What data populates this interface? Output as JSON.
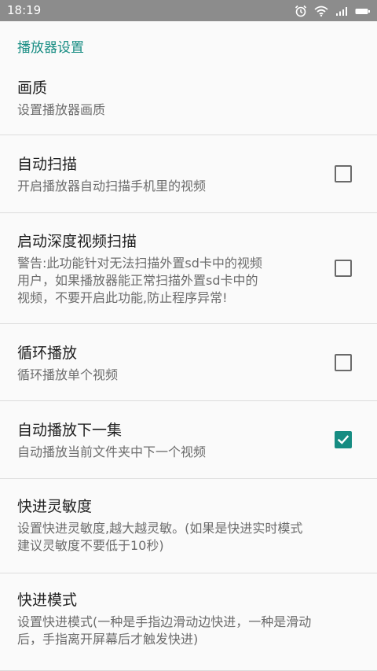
{
  "status_bar": {
    "time": "18:19",
    "icons": [
      "alarm-icon",
      "wifi-icon",
      "signal-icon",
      "battery-icon"
    ]
  },
  "colors": {
    "accent": "#168c82",
    "status_bar": "#8c8c8c",
    "background": "#fafafa"
  },
  "section": {
    "title": "播放器设置"
  },
  "preferences": [
    {
      "title": "画质",
      "summary": "设置播放器画质",
      "has_checkbox": false
    },
    {
      "title": "自动扫描",
      "summary": "开启播放器自动扫描手机里的视频",
      "has_checkbox": true,
      "checked": false
    },
    {
      "title": "启动深度视频扫描",
      "summary": "警告:此功能针对无法扫描外置sd卡中的视频\n用户，如果播放器能正常扫描外置sd卡中的\n视频，不要开启此功能,防止程序异常!",
      "has_checkbox": true,
      "checked": false
    },
    {
      "title": "循环播放",
      "summary": "循环播放单个视频",
      "has_checkbox": true,
      "checked": false
    },
    {
      "title": "自动播放下一集",
      "summary": "自动播放当前文件夹中下一个视频",
      "has_checkbox": true,
      "checked": true
    },
    {
      "title": "快进灵敏度",
      "summary": "设置快进灵敏度,越大越灵敏。(如果是快进实时模式\n建议灵敏度不要低于10秒)",
      "has_checkbox": false
    },
    {
      "title": "快进模式",
      "summary": "设置快进模式(一种是手指边滑动边快进，一种是滑动\n后，手指离开屏幕后才触发快进)",
      "has_checkbox": false
    }
  ]
}
